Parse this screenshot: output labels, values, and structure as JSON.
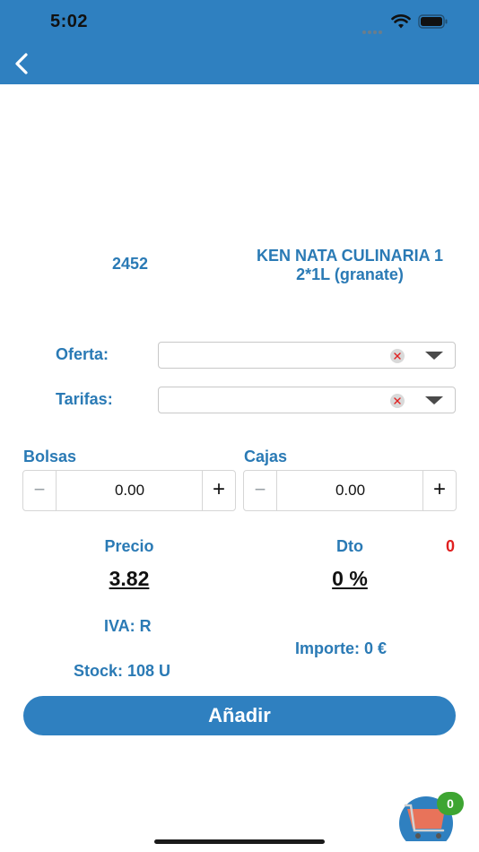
{
  "status_bar": {
    "time": "5:02"
  },
  "product": {
    "code": "2452",
    "name": "KEN NATA CULINARIA 1 2*1L (granate)"
  },
  "filters": {
    "oferta": {
      "label": "Oferta:",
      "value": ""
    },
    "tarifas": {
      "label": "Tarifas:",
      "value": ""
    }
  },
  "quantities": {
    "bolsas": {
      "label": "Bolsas",
      "value": "0.00",
      "minus": "−",
      "plus": "+"
    },
    "cajas": {
      "label": "Cajas",
      "value": "0.00",
      "minus": "−",
      "plus": "+"
    }
  },
  "pricing": {
    "precio_label": "Precio",
    "precio_value": "3.82",
    "dto_label": "Dto",
    "dto_value": "0 %",
    "dto_count": "0",
    "iva": "IVA: R",
    "importe": "Importe: 0 €",
    "stock": "Stock: 108 U"
  },
  "actions": {
    "add_label": "Añadir"
  },
  "cart": {
    "count": "0"
  },
  "colors": {
    "brand": "#2f80c0",
    "label_text": "#2a7ab5",
    "alert_red": "#e02020",
    "badge_green": "#3ea532",
    "cart_orange": "#e8735a"
  }
}
